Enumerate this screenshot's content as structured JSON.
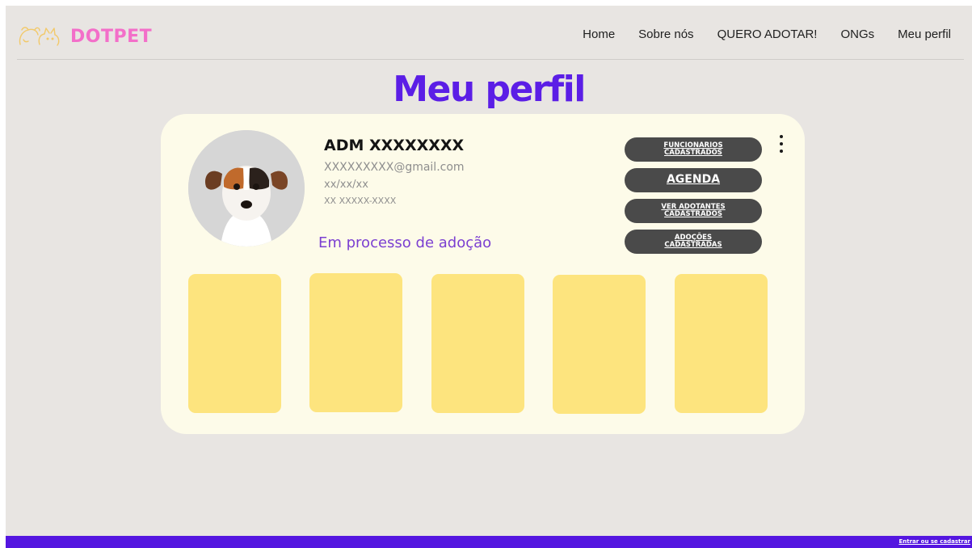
{
  "brand": {
    "name": "DOTPET",
    "logo_icon": "dog-cat-outline-icon",
    "color": "#f36fc9"
  },
  "nav": {
    "items": [
      {
        "label": "Home"
      },
      {
        "label": "Sobre nós"
      },
      {
        "label": "QUERO ADOTAR!"
      },
      {
        "label": "ONGs"
      },
      {
        "label": "Meu perfil"
      }
    ]
  },
  "page": {
    "title": "Meu perfil",
    "title_color": "#5b1ee6",
    "background": "#e8e5e2"
  },
  "profile": {
    "avatar": "dog-photo",
    "name": "ADM XXXXXXXX",
    "email": "XXXXXXXXX@gmail.com",
    "birthdate": "xx/xx/xx",
    "phone": "XX XXXXX-XXXX",
    "status_label": "Em processo de adoção",
    "card_color": "#fdfbe9"
  },
  "admin_buttons": {
    "funcionarios": {
      "line1": "FUNCIONARIOS",
      "line2": "CADASTRADOS"
    },
    "agenda": {
      "label": "AGENDA"
    },
    "adotantes": {
      "line1": "VER ADOTANTES",
      "line2": "CADASTRADOS"
    },
    "adocoes": {
      "line1": "ADOÇÕES",
      "line2": "CADASTRADAS"
    },
    "button_color": "#4a4a4a"
  },
  "menu_icon": "more-vertical-icon",
  "pet_tiles": {
    "count": 5,
    "color": "#fde47e"
  },
  "footer": {
    "link_label": "Entrar ou se cadastrar",
    "color": "#5416e0"
  }
}
